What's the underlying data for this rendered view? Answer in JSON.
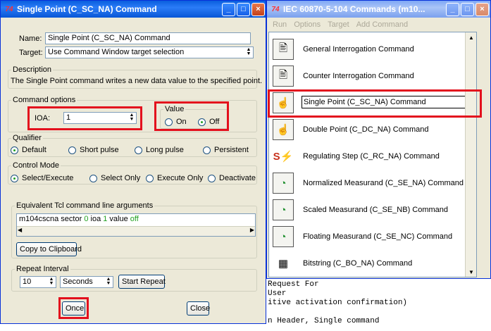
{
  "dialog": {
    "title": "Single Point (C_SC_NA) Command",
    "name_label": "Name:",
    "name_value": "Single Point (C_SC_NA) Command",
    "target_label": "Target:",
    "target_value": "Use Command Window target selection",
    "description_title": "Description",
    "description_text": "The Single Point command writes a new data value to the specified point.",
    "command_options_title": "Command options",
    "ioa_label": "IOA:",
    "ioa_value": "1",
    "value_title": "Value",
    "value_on": "On",
    "value_off": "Off",
    "value_selected": "Off",
    "qualifier_title": "Qualifier",
    "qualifier_options": [
      "Default",
      "Short pulse",
      "Long pulse",
      "Persistent"
    ],
    "qualifier_selected": "Default",
    "control_mode_title": "Control Mode",
    "control_mode_options": [
      "Select/Execute",
      "Select Only",
      "Execute Only",
      "Deactivate"
    ],
    "control_mode_selected": "Select/Execute",
    "tcl_title": "Equivalent Tcl command line arguments",
    "tcl_parts": {
      "a": "m104cscna sector ",
      "b": "0",
      "c": " ioa ",
      "d": "1",
      "e": "  value ",
      "f": "off"
    },
    "copy_button": "Copy to Clipboard",
    "repeat_title": "Repeat Interval",
    "repeat_value": "10",
    "repeat_unit": "Seconds",
    "start_repeat_button": "Start Repeat",
    "once_button": "Once",
    "close_button": "Close"
  },
  "commands_window": {
    "title": "IEC 60870-5-104 Commands (m10...",
    "menu": [
      "Run",
      "Options",
      "Target",
      "Add Command"
    ],
    "items": [
      {
        "label": "General Interrogation Command",
        "icon": "interrogation-icon"
      },
      {
        "label": "Counter Interrogation Command",
        "icon": "interrogation-icon"
      },
      {
        "label": "Single Point (C_SC_NA) Command",
        "icon": "hand-switch-icon"
      },
      {
        "label": "Double Point (C_DC_NA) Command",
        "icon": "hand-switch-icon"
      },
      {
        "label": "Regulating Step (C_RC_NA) Command",
        "icon": "regulating-step-icon"
      },
      {
        "label": "Normalized Measurand (C_SE_NA) Command",
        "icon": "gauge-icon"
      },
      {
        "label": "Scaled Measurand (C_SE_NB) Command",
        "icon": "gauge-icon"
      },
      {
        "label": "Floating Measurand (C_SE_NC) Command",
        "icon": "gauge-icon"
      },
      {
        "label": "Bitstring (C_BO_NA) Command",
        "icon": "chip-icon"
      }
    ],
    "selected": "Single Point (C_SC_NA) Command"
  },
  "console": {
    "lines": [
      "Request For",
      "User",
      "itive activation confirmation)",
      "",
      "n Header, Single command"
    ]
  },
  "colors": {
    "highlight": "#e3101d",
    "tcl_value": "#21a121",
    "title_bar": "#0a5ede"
  }
}
